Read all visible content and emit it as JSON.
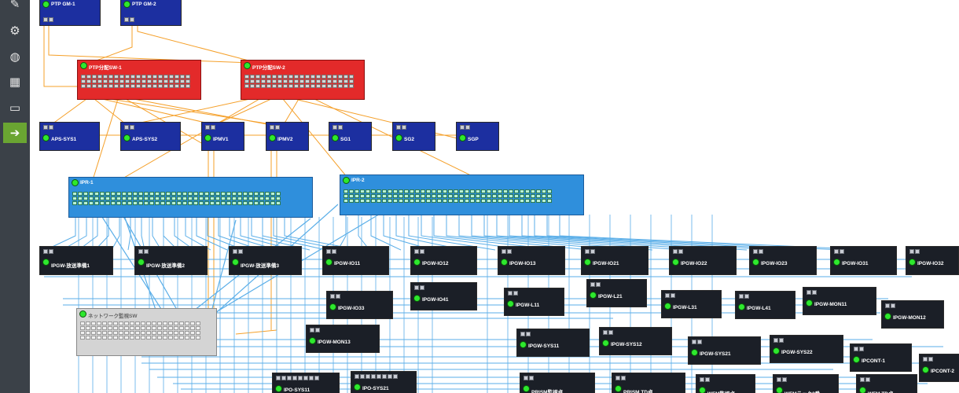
{
  "sidebar": {
    "items": [
      {
        "name": "edit-icon",
        "glyph": "✎"
      },
      {
        "name": "puzzle-icon",
        "glyph": "⚙"
      },
      {
        "name": "globe-icon",
        "glyph": "◍"
      },
      {
        "name": "table-icon",
        "glyph": "▦"
      },
      {
        "name": "monitor-icon",
        "glyph": "▭"
      },
      {
        "name": "arrow-right-icon",
        "glyph": "➔"
      }
    ]
  },
  "colors": {
    "sidebar_bg": "#3b4148",
    "active": "#6aa532",
    "wire_orange": "#f5a02a",
    "wire_blue": "#5aaee8",
    "node_blue": "#1c2fa0",
    "node_red": "#e32a2a",
    "node_lightblue": "#2f8fdc",
    "node_dark": "#1b1f27",
    "status_green": "#2ee82e"
  },
  "diagram": {
    "ptp_gm": [
      "PTP GM-1",
      "PTP GM-2"
    ],
    "ptp_switches": [
      "PTP分配SW-1",
      "PTP分配SW-2"
    ],
    "systems": [
      "APS-SYS1",
      "APS-SYS2",
      "IPMV1",
      "IPMV2",
      "SG1",
      "SG2",
      "SGP"
    ],
    "ip_switches": [
      "IPR-1",
      "IPR-2"
    ],
    "gateways_row1": [
      "IPGW-放送準備1",
      "IPGW-放送準備2",
      "IPGW-放送準備3",
      "IPGW-IO11",
      "IPGW-IO12",
      "IPGW-IO13",
      "IPGW-IO21",
      "IPGW-IO22",
      "IPGW-IO23",
      "IPGW-IO31",
      "IPGW-IO32"
    ],
    "gateways_row2": [
      "IPGW-IO41",
      "IPGW-L21",
      "IPGW-IO33",
      "IPGW-L11",
      "IPGW-L31",
      "IPGW-L41",
      "IPGW-MON11",
      "IPGW-MON12"
    ],
    "gateways_row3": [
      "IPGW-MON13",
      "IPGW-SYS11",
      "IPGW-SYS12",
      "IPGW-SYS21",
      "IPGW-SYS22",
      "IPCONT-1",
      "IPCONT-2"
    ],
    "gateways_row4": [
      "IPO-SYS11",
      "IPO-SYS21",
      "PRISM監視卓",
      "PRISM TD卓",
      "WFM監視卓",
      "WFMラック2番",
      "WFM TD卓"
    ],
    "gray_switch": "ネットワーク監視SW"
  }
}
